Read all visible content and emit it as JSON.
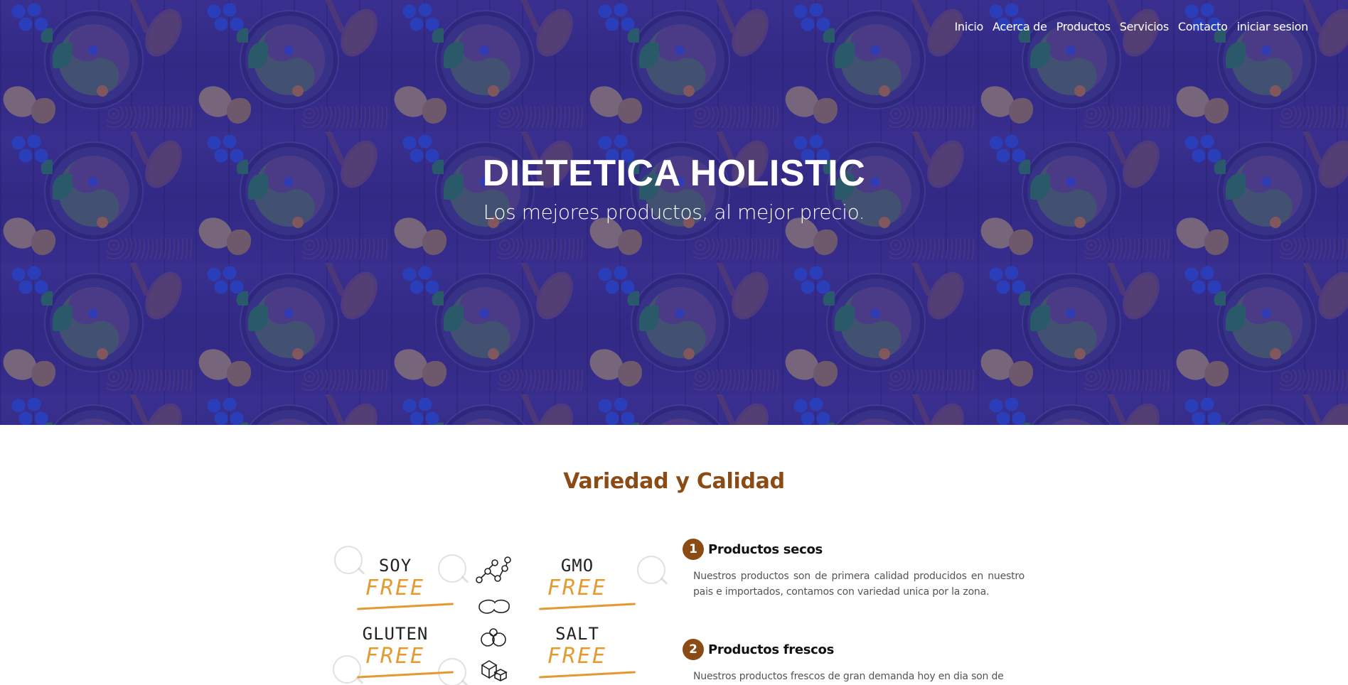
{
  "nav": {
    "items": [
      {
        "label": "Inicio"
      },
      {
        "label": "Acerca de"
      },
      {
        "label": "Productos"
      },
      {
        "label": "Servicios"
      },
      {
        "label": "Contacto"
      },
      {
        "label": "iniciar sesion"
      }
    ]
  },
  "hero": {
    "title": "DIETETICA HOLISTIC",
    "subtitle": "Los mejores productos, al mejor precio."
  },
  "section": {
    "title": "Variedad y Calidad"
  },
  "illustration": {
    "badges": [
      {
        "word": "SOY",
        "suffix": "FREE"
      },
      {
        "word": "GMO",
        "suffix": "FREE"
      },
      {
        "word": "GLUTEN",
        "suffix": "FREE"
      },
      {
        "word": "SALT",
        "suffix": "FREE"
      }
    ],
    "colors": {
      "free": "#e49a2c",
      "ink": "#222222"
    }
  },
  "features": [
    {
      "number": "1",
      "title": "Productos secos",
      "text": "Nuestros productos son de primera calidad producidos en nuestro pais e importados, contamos con variedad unica por la zona."
    },
    {
      "number": "2",
      "title": "Productos frescos",
      "text": "Nuestros productos frescos de gran demanda hoy en dia son de"
    }
  ],
  "colors": {
    "accent": "#8a4b14",
    "hero_overlay": "#261c96",
    "nav_text": "#ffffff"
  }
}
